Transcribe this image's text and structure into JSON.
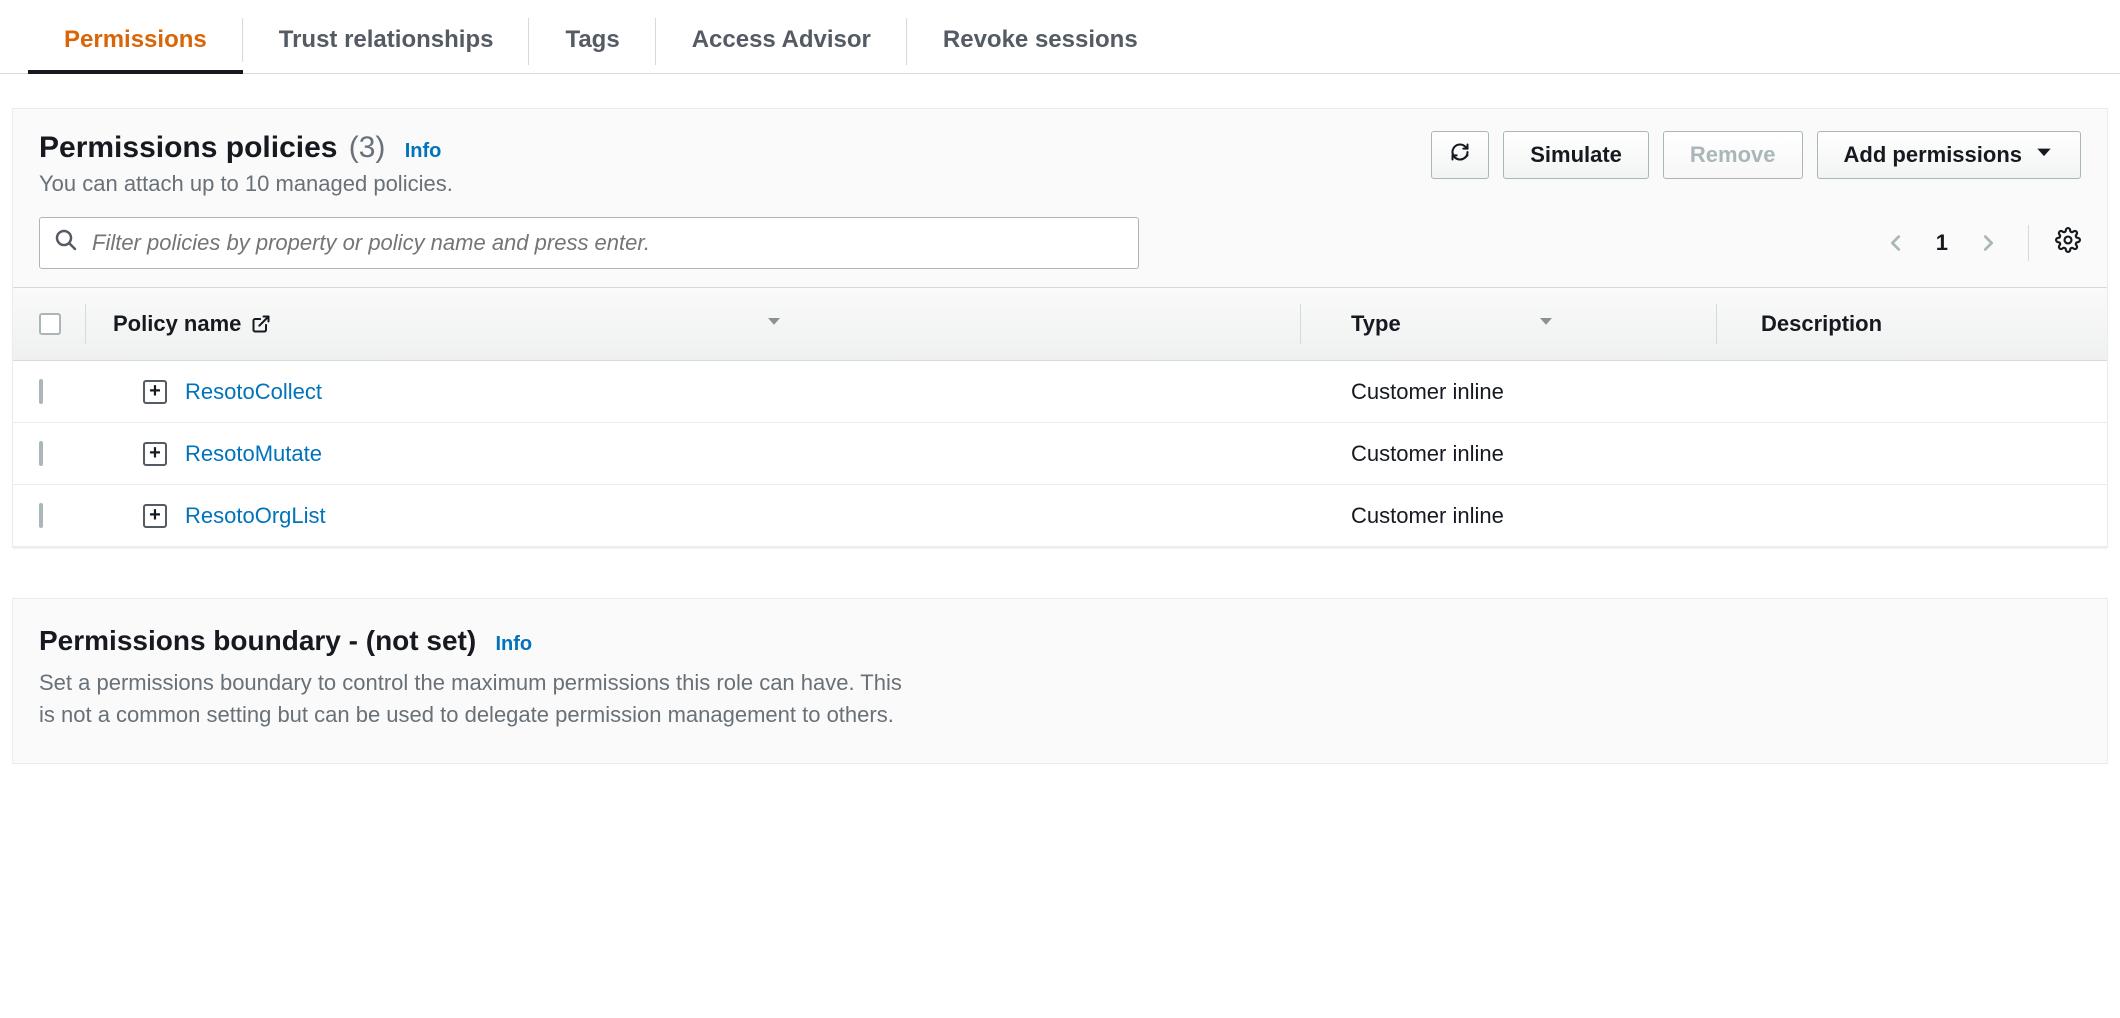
{
  "tabs": {
    "items": [
      {
        "label": "Permissions",
        "active": true
      },
      {
        "label": "Trust relationships",
        "active": false
      },
      {
        "label": "Tags",
        "active": false
      },
      {
        "label": "Access Advisor",
        "active": false
      },
      {
        "label": "Revoke sessions",
        "active": false
      }
    ]
  },
  "policies_panel": {
    "title": "Permissions policies",
    "count_label": "(3)",
    "info_label": "Info",
    "subtitle": "You can attach up to 10 managed policies.",
    "buttons": {
      "simulate": "Simulate",
      "remove": "Remove",
      "add_permissions": "Add permissions"
    },
    "search_placeholder": "Filter policies by property or policy name and press enter.",
    "page_number": "1",
    "columns": {
      "policy_name": "Policy name",
      "type": "Type",
      "description": "Description"
    },
    "rows": [
      {
        "name": "ResotoCollect",
        "type": "Customer inline",
        "description": ""
      },
      {
        "name": "ResotoMutate",
        "type": "Customer inline",
        "description": ""
      },
      {
        "name": "ResotoOrgList",
        "type": "Customer inline",
        "description": ""
      }
    ]
  },
  "boundary_panel": {
    "title": "Permissions boundary - (not set)",
    "info_label": "Info",
    "description": "Set a permissions boundary to control the maximum permissions this role can have. This is not a common setting but can be used to delegate permission management to others."
  }
}
